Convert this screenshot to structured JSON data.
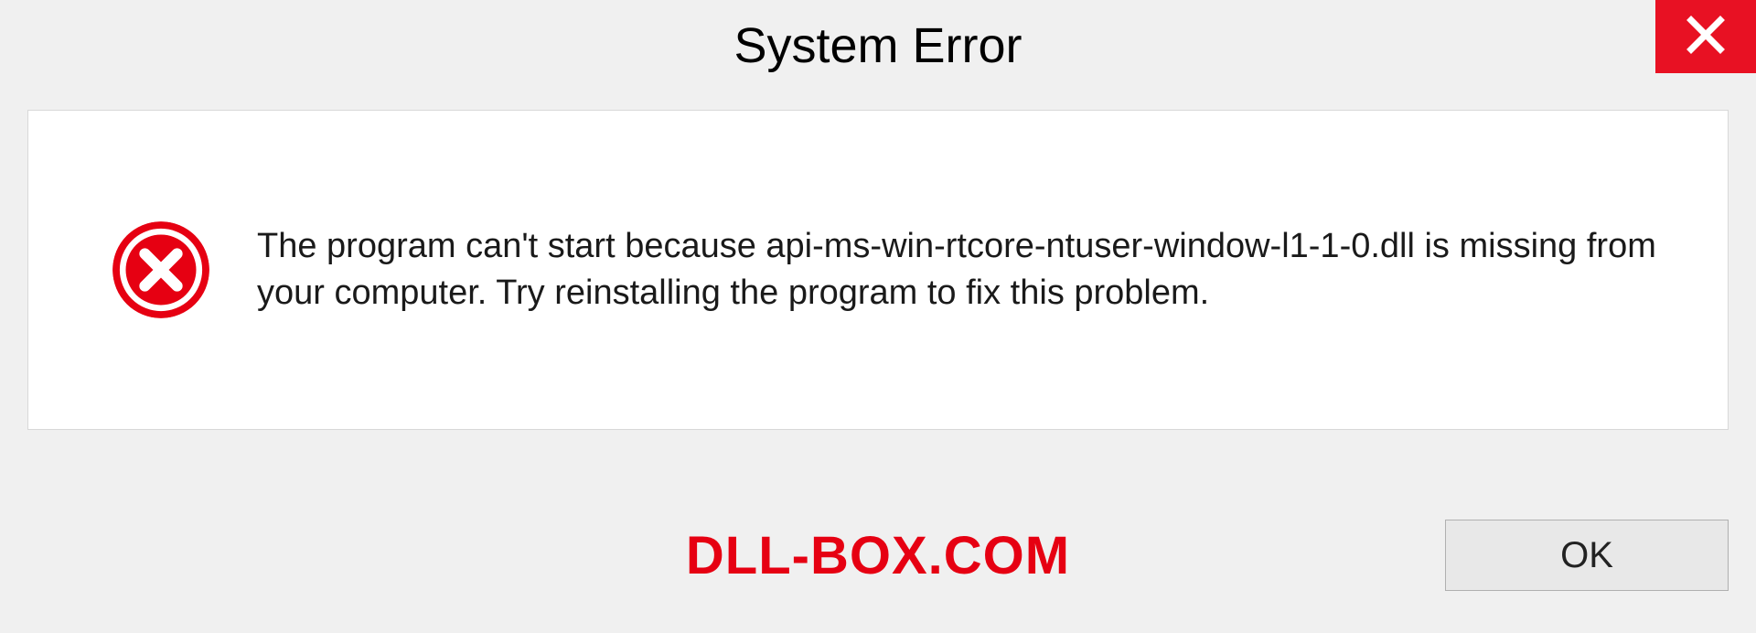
{
  "dialog": {
    "title": "System Error",
    "message": "The program can't start because api-ms-win-rtcore-ntuser-window-l1-1-0.dll is missing from your computer. Try reinstalling the program to fix this problem.",
    "ok_label": "OK"
  },
  "watermark": "DLL-BOX.COM",
  "colors": {
    "close_bg": "#e81123",
    "error_red": "#e60012",
    "panel_bg": "#ffffff",
    "page_bg": "#f0f0f0"
  }
}
